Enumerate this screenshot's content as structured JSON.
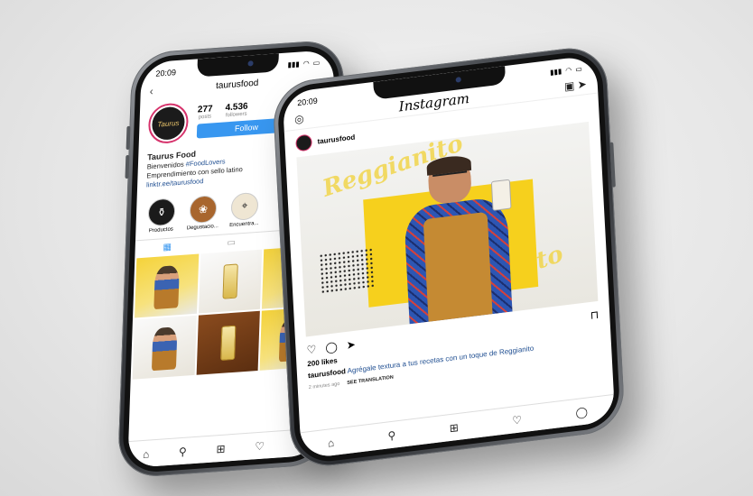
{
  "profile_screen": {
    "status_time": "20:09",
    "username": "taurusfood",
    "back_symbol": "‹",
    "avatar_text": "Taurus",
    "stats": [
      {
        "num": "277",
        "label": "posts"
      },
      {
        "num": "4.536",
        "label": "followers"
      }
    ],
    "follow_label": "Follow",
    "bio": {
      "name": "Taurus Food",
      "line1_prefix": "Bienvenidos ",
      "line1_tag": "#FoodLovers",
      "line2": "Emprendimiento con sello latino",
      "link": "linktr.ee/taurusfood"
    },
    "highlights": [
      {
        "label": "Productos",
        "icon": "bottle-icon"
      },
      {
        "label": "Degustacio...",
        "icon": "food-icon"
      },
      {
        "label": "Encuentra...",
        "icon": "location-icon"
      }
    ]
  },
  "post_screen": {
    "status_time": "20:09",
    "logo": "Instagram",
    "username": "taurusfood",
    "image_text_top": "Reggianito",
    "image_text_bottom": "Reggianito",
    "likes": "200 likes",
    "caption_user": "taurusfood",
    "caption_text": " Agrégale textura a tus recetas con un toque de Reggianito",
    "meta_time": "2 minutes ago",
    "meta_see": "SEE TRANSLATION"
  },
  "icons": {
    "camera": "camera-icon",
    "igtv": "igtv-icon",
    "direct": "direct-icon",
    "heart": "heart-icon",
    "comment": "comment-icon",
    "share": "share-icon",
    "bookmark": "bookmark-icon",
    "home": "home-icon",
    "search": "search-icon",
    "add": "add-icon",
    "activity": "activity-icon",
    "profile": "profile-icon"
  },
  "colors": {
    "follow_blue": "#3897f0",
    "story_ring": "#d6326b",
    "brand_yellow": "#f6d01d",
    "link_blue": "#1f4e91"
  }
}
